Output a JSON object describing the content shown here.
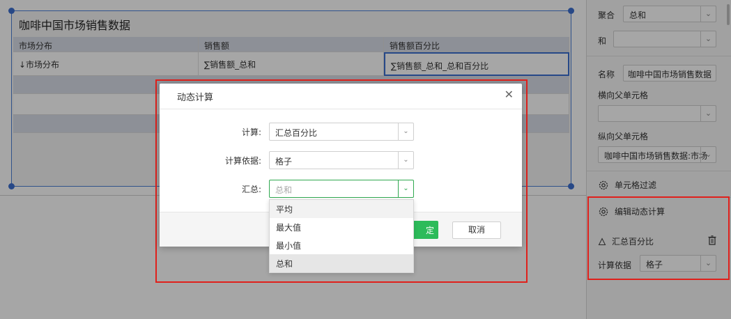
{
  "table": {
    "title": "咖啡中国市场销售数据",
    "headers": [
      "市场分布",
      "销售额",
      "销售额百分比"
    ],
    "row": [
      "↓市场分布",
      "∑销售额_总和",
      "∑销售额_总和_总和百分比"
    ]
  },
  "dialog": {
    "title": "动态计算",
    "close_glyph": "✕",
    "fields": {
      "calc_label": "计算:",
      "calc_value": "汇总百分比",
      "basis_label": "计算依据:",
      "basis_value": "格子",
      "summary_label": "汇总:",
      "summary_placeholder": "总和"
    },
    "dropdown_options": [
      "平均",
      "最大值",
      "最小值",
      "总和"
    ],
    "ok_label": "定",
    "cancel_label": "取消"
  },
  "panel": {
    "aggregate_label": "聚合",
    "aggregate_value": "总和",
    "sum_label": "和",
    "name_label": "名称",
    "name_value": "咖啡中国市场销售数据",
    "h_parent_label": "横向父单元格",
    "v_parent_label": "纵向父单元格",
    "v_parent_value": "咖啡中国市场销售数据:市场",
    "cell_filter_label": "单元格过滤",
    "edit_dynamic_label": "编辑动态计算",
    "calc_item_label": "汇总百分比",
    "basis_label": "计算依据",
    "basis_value": "格子"
  },
  "colors": {
    "accent_green": "#2dbb5a",
    "highlight_red": "#e0201b",
    "selection_blue": "#3d6fcf"
  },
  "icons": {
    "caret": "chevron-down-icon",
    "gear": "gear-icon",
    "delta": "delta-icon",
    "trash": "trash-icon"
  }
}
